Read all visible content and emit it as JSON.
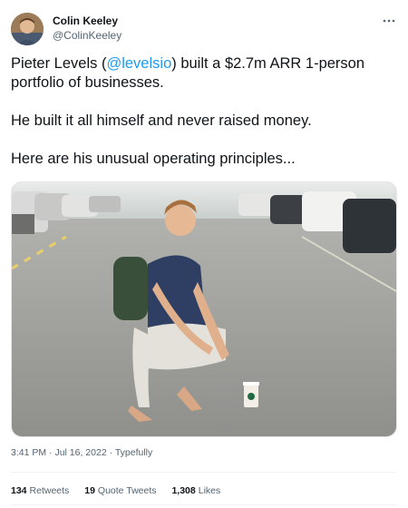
{
  "author": {
    "name": "Colin Keeley",
    "handle": "@ColinKeeley"
  },
  "tweet": {
    "line1_pre": "Pieter Levels (",
    "mention": "@levelsio",
    "line1_post": ") built a $2.7m ARR 1-person portfolio of businesses.",
    "line2": "He built it all himself and never raised money.",
    "line3": "Here are his unusual operating principles..."
  },
  "meta": {
    "time": "3:41 PM",
    "sep1": " · ",
    "date": "Jul 16, 2022",
    "sep2": " · ",
    "source": "Typefully"
  },
  "stats": {
    "retweets_count": "134",
    "retweets_label": "Retweets",
    "quotes_count": "19",
    "quotes_label": "Quote Tweets",
    "likes_count": "1,308",
    "likes_label": "Likes"
  },
  "icons": {
    "more": "more-horizontal-icon",
    "avatar": "profile-avatar"
  }
}
